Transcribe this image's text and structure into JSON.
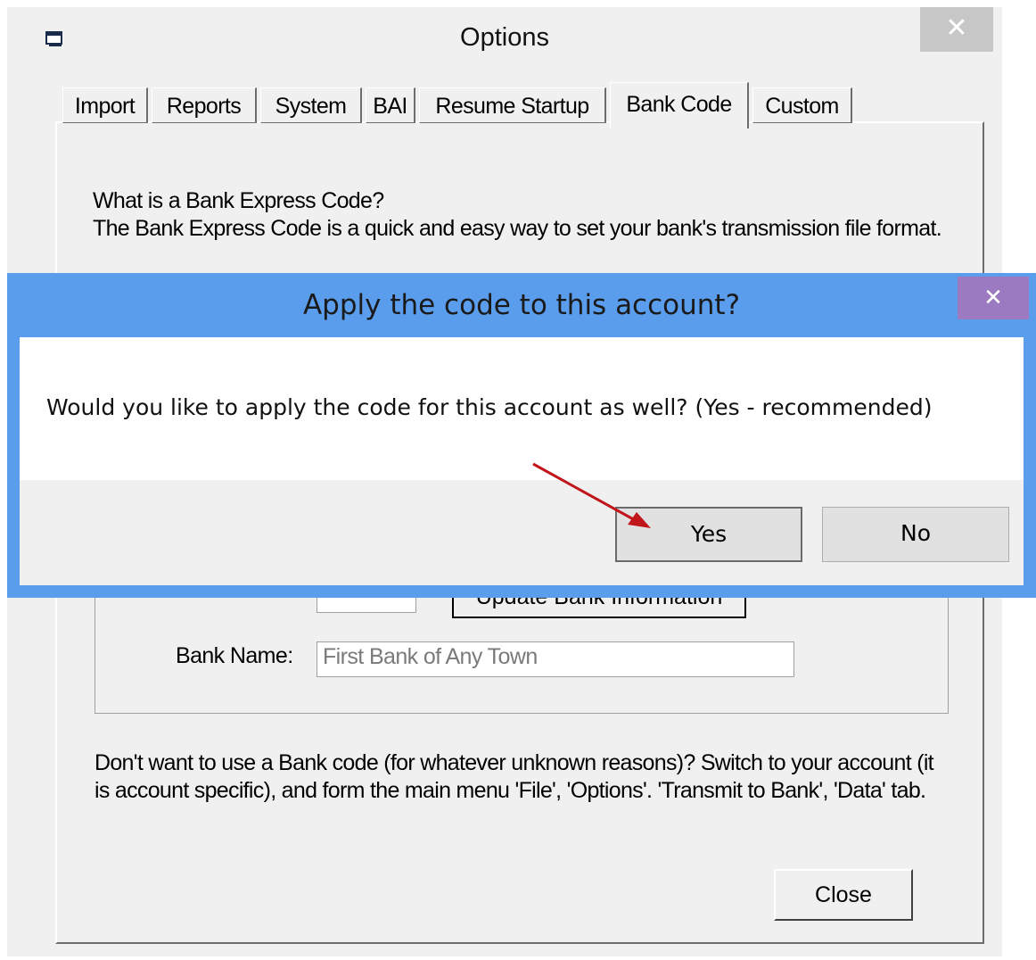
{
  "options_window": {
    "title": "Options",
    "close_glyph": "✕",
    "tabs": [
      {
        "label": "Import"
      },
      {
        "label": "Reports"
      },
      {
        "label": "System"
      },
      {
        "label": "BAI"
      },
      {
        "label": "Resume Startup"
      },
      {
        "label": "Bank Code",
        "active": true
      },
      {
        "label": "Custom"
      }
    ],
    "intro_heading": "What is a Bank Express Code?",
    "intro_text": "The Bank Express Code is a quick and easy way to set your bank's transmission file format.",
    "update_bank_button": "Update Bank Information",
    "bank_name_label": "Bank Name:",
    "bank_name_value": "First Bank of Any Town",
    "footer_text": "Don't want to use a Bank code (for whatever unknown reasons)?  Switch to your account (it is account specific), and form the main menu 'File', 'Options'. 'Transmit to Bank', 'Data' tab.",
    "close_button": "Close"
  },
  "dialog": {
    "title": "Apply the code to this account?",
    "close_glyph": "✕",
    "message": "Would you like to apply the code for this account as well? (Yes - recommended)",
    "yes_button": "Yes",
    "no_button": "No",
    "accent_color": "#5b9ded"
  },
  "annotation": {
    "arrow_color": "#c0161b",
    "points_to": "yes-button"
  }
}
